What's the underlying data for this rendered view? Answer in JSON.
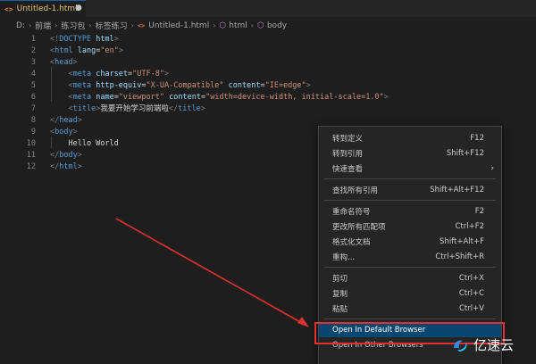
{
  "tab": {
    "label": "Untitled-1.html",
    "icon": "html-file-icon"
  },
  "breadcrumb": [
    "D:",
    "前端",
    "练习包",
    "标签练习",
    "Untitled-1.html",
    "html",
    "body"
  ],
  "editor": {
    "line_numbers": [
      "1",
      "2",
      "3",
      "4",
      "5",
      "6",
      "7",
      "8",
      "9",
      "10",
      "11",
      "12"
    ],
    "lines": [
      [
        [
          "t-gray",
          "<!"
        ],
        [
          "t-tag",
          "DOCTYPE"
        ],
        [
          "t-attr",
          " html"
        ],
        [
          "t-gray",
          ">"
        ]
      ],
      [
        [
          "t-gray",
          "<"
        ],
        [
          "t-tag",
          "html"
        ],
        [
          "t-attr",
          " lang"
        ],
        [
          "t-txt",
          "="
        ],
        [
          "t-str",
          "\"en\""
        ],
        [
          "t-gray",
          ">"
        ]
      ],
      [
        [
          "t-gray",
          "<"
        ],
        [
          "t-tag",
          "head"
        ],
        [
          "t-gray",
          ">"
        ]
      ],
      [
        [
          "t-txt",
          "    "
        ],
        [
          "t-gray",
          "<"
        ],
        [
          "t-tag",
          "meta"
        ],
        [
          "t-attr",
          " charset"
        ],
        [
          "t-txt",
          "="
        ],
        [
          "t-str",
          "\"UTF-8\""
        ],
        [
          "t-gray",
          ">"
        ]
      ],
      [
        [
          "t-txt",
          "    "
        ],
        [
          "t-gray",
          "<"
        ],
        [
          "t-tag",
          "meta"
        ],
        [
          "t-attr",
          " http-equiv"
        ],
        [
          "t-txt",
          "="
        ],
        [
          "t-str",
          "\"X-UA-Compatible\""
        ],
        [
          "t-attr",
          " content"
        ],
        [
          "t-txt",
          "="
        ],
        [
          "t-str",
          "\"IE=edge\""
        ],
        [
          "t-gray",
          ">"
        ]
      ],
      [
        [
          "t-txt",
          "    "
        ],
        [
          "t-gray",
          "<"
        ],
        [
          "t-tag",
          "meta"
        ],
        [
          "t-attr",
          " name"
        ],
        [
          "t-txt",
          "="
        ],
        [
          "t-str",
          "\"viewport\""
        ],
        [
          "t-attr",
          " content"
        ],
        [
          "t-txt",
          "="
        ],
        [
          "t-str",
          "\"width=device-width, initial-scale=1.0\""
        ],
        [
          "t-gray",
          ">"
        ]
      ],
      [
        [
          "t-txt",
          "    "
        ],
        [
          "t-gray",
          "<"
        ],
        [
          "t-tag",
          "title"
        ],
        [
          "t-gray",
          ">"
        ],
        [
          "t-txt",
          "我要开始学习前端啦"
        ],
        [
          "t-gray",
          "</"
        ],
        [
          "t-tag",
          "title"
        ],
        [
          "t-gray",
          ">"
        ]
      ],
      [
        [
          "t-gray",
          "</"
        ],
        [
          "t-tag",
          "head"
        ],
        [
          "t-gray",
          ">"
        ]
      ],
      [
        [
          "t-gray",
          "<"
        ],
        [
          "t-tag",
          "body"
        ],
        [
          "t-gray",
          ">"
        ]
      ],
      [
        [
          "t-txt",
          "    Hello World"
        ]
      ],
      [
        [
          "t-gray",
          "</"
        ],
        [
          "t-tag",
          "body"
        ],
        [
          "t-gray",
          ">"
        ]
      ],
      [
        [
          "t-gray",
          "</"
        ],
        [
          "t-tag",
          "html"
        ],
        [
          "t-gray",
          ">"
        ]
      ]
    ]
  },
  "context_menu": {
    "items": [
      {
        "label": "转到定义",
        "shortcut": "F12"
      },
      {
        "label": "转到引用",
        "shortcut": "Shift+F12"
      },
      {
        "label": "快速查看",
        "shortcut": "",
        "submenu": true
      },
      {
        "separator": true
      },
      {
        "label": "查找所有引用",
        "shortcut": "Shift+Alt+F12"
      },
      {
        "separator": true
      },
      {
        "label": "重命名符号",
        "shortcut": "F2"
      },
      {
        "label": "更改所有匹配项",
        "shortcut": "Ctrl+F2"
      },
      {
        "label": "格式化文档",
        "shortcut": "Shift+Alt+F"
      },
      {
        "label": "重构...",
        "shortcut": "Ctrl+Shift+R"
      },
      {
        "separator": true
      },
      {
        "label": "剪切",
        "shortcut": "Ctrl+X"
      },
      {
        "label": "复制",
        "shortcut": "Ctrl+C"
      },
      {
        "label": "粘贴",
        "shortcut": "Ctrl+V"
      },
      {
        "separator": true
      },
      {
        "label": "Open In Default Browser",
        "shortcut": "",
        "active": true
      },
      {
        "label": "Open In Other Browsers",
        "shortcut": ""
      }
    ]
  },
  "watermark": {
    "text": "亿速云"
  },
  "colors": {
    "background": "#1e1e1e",
    "menu": "#252526",
    "active": "#094771",
    "highlight": "#e03030",
    "arrow": "#e03030"
  }
}
